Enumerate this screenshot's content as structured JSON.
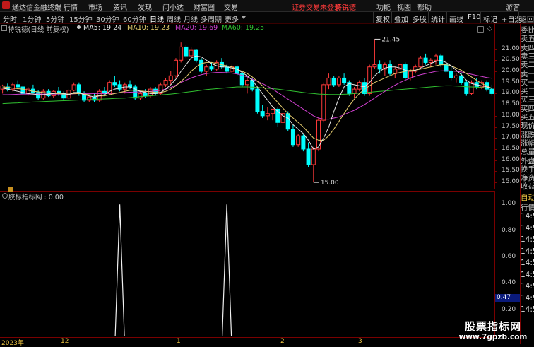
{
  "titlebar": {
    "app_name": "通达信金融终端",
    "menus": [
      "行情",
      "市场",
      "资讯",
      "发现",
      "问小达",
      "财富圈",
      "交易"
    ],
    "notice": "证券交易未登录",
    "stock_name": "特锐德",
    "right_items": [
      "功能",
      "视图",
      "帮助",
      "游客"
    ]
  },
  "toolbar": {
    "periods": [
      "分时",
      "1分钟",
      "5分钟",
      "15分钟",
      "30分钟",
      "60分钟",
      "日线",
      "周线",
      "月线",
      "多周期",
      "更多"
    ],
    "active_period": "日线",
    "right_buttons": [
      "复权",
      "叠加",
      "多股",
      "统计",
      "画线",
      "F10",
      "标记",
      "+自选",
      "返回"
    ]
  },
  "legend": {
    "title": "特锐德(日线 前复权)",
    "ma5": "MA5: 19.24",
    "ma10": "MA10: 19.23",
    "ma20": "MA20: 19.69",
    "ma60": "MA60: 19.25"
  },
  "colors": {
    "up": "#ff3a3a",
    "down": "#00ffff",
    "ma5": "#e8e8e8",
    "ma10": "#e8d070",
    "ma20": "#d040d0",
    "ma60": "#30c030",
    "axis": "#7a0000"
  },
  "price_axis": [
    "21.00",
    "20.50",
    "20.00",
    "19.50",
    "19.00",
    "18.50",
    "18.00",
    "17.50",
    "17.00",
    "16.50",
    "16.00",
    "15.50",
    "15.00"
  ],
  "annotations": {
    "high": "21.45",
    "low": "15.00"
  },
  "sub_panel": {
    "title": "胶标指标网 : 0.00",
    "axis": [
      "1.00",
      "0.80",
      "0.60",
      "0.40",
      "0.20"
    ],
    "current_value": "0.47"
  },
  "date_axis": [
    "2023年",
    "12",
    "1",
    "2",
    "3"
  ],
  "sidebar": {
    "top_labels": [
      "委比",
      "卖五",
      "卖四",
      "卖三",
      "卖二",
      "卖一",
      "买一",
      "买二",
      "买三",
      "买四",
      "买五",
      "现价",
      "涨跌",
      "涨幅",
      "总量",
      "外盘",
      "换手",
      "净资",
      "收益"
    ],
    "auto_label": "自动",
    "market_label": "行情",
    "times": [
      "14:5",
      "14:5",
      "14:5",
      "14:5",
      "14:5",
      "14:5",
      "14:5",
      "14:5",
      "14:5"
    ]
  },
  "watermark": {
    "line1": "股票指标网",
    "line2": "www.7gpzb.com"
  },
  "chart_data": {
    "type": "candlestick",
    "ylim": [
      14.75,
      21.75
    ],
    "candles": [
      [
        19.2,
        19.4,
        19.0,
        19.35
      ],
      [
        19.3,
        19.45,
        19.1,
        19.2
      ],
      [
        19.2,
        19.5,
        19.1,
        19.4
      ],
      [
        19.4,
        19.6,
        19.2,
        19.3
      ],
      [
        19.3,
        19.4,
        18.9,
        19.0
      ],
      [
        19.0,
        19.3,
        18.9,
        19.2
      ],
      [
        19.2,
        19.4,
        19.0,
        19.05
      ],
      [
        19.05,
        19.15,
        18.7,
        18.8
      ],
      [
        18.8,
        19.2,
        18.7,
        19.1
      ],
      [
        19.1,
        19.2,
        18.85,
        18.9
      ],
      [
        18.9,
        19.15,
        18.8,
        19.1
      ],
      [
        19.1,
        19.3,
        18.9,
        19.0
      ],
      [
        19.0,
        19.1,
        18.7,
        18.8
      ],
      [
        18.8,
        19.2,
        18.7,
        19.15
      ],
      [
        19.15,
        19.5,
        19.1,
        19.4
      ],
      [
        19.4,
        19.5,
        18.9,
        19.0
      ],
      [
        19.0,
        19.1,
        18.6,
        18.7
      ],
      [
        18.7,
        18.9,
        18.6,
        18.85
      ],
      [
        18.85,
        19.0,
        18.6,
        18.7
      ],
      [
        18.7,
        19.2,
        18.6,
        19.1
      ],
      [
        19.1,
        19.3,
        18.9,
        19.0
      ],
      [
        19.0,
        19.6,
        18.95,
        19.5
      ],
      [
        19.5,
        19.8,
        19.3,
        19.4
      ],
      [
        19.4,
        19.6,
        19.1,
        19.2
      ],
      [
        19.2,
        19.5,
        19.0,
        19.4
      ],
      [
        19.4,
        19.6,
        19.2,
        19.3
      ],
      [
        19.3,
        19.4,
        18.7,
        18.8
      ],
      [
        18.8,
        19.1,
        18.7,
        19.0
      ],
      [
        19.0,
        19.2,
        18.8,
        18.9
      ],
      [
        18.9,
        19.3,
        18.8,
        19.2
      ],
      [
        19.2,
        19.3,
        18.9,
        19.0
      ],
      [
        19.0,
        19.5,
        18.95,
        19.4
      ],
      [
        19.4,
        19.7,
        19.3,
        19.6
      ],
      [
        19.6,
        20.0,
        19.4,
        19.8
      ],
      [
        19.8,
        20.6,
        19.7,
        20.5
      ],
      [
        20.5,
        21.3,
        20.4,
        21.1
      ],
      [
        21.1,
        21.2,
        20.6,
        20.7
      ],
      [
        20.7,
        21.1,
        20.6,
        20.95
      ],
      [
        20.95,
        21.0,
        20.4,
        20.5
      ],
      [
        20.5,
        20.6,
        19.9,
        20.0
      ],
      [
        20.0,
        20.3,
        19.8,
        20.2
      ],
      [
        20.2,
        20.4,
        20.0,
        20.1
      ],
      [
        20.1,
        20.5,
        20.0,
        20.4
      ],
      [
        20.4,
        20.6,
        20.1,
        20.2
      ],
      [
        20.2,
        20.3,
        19.9,
        20.0
      ],
      [
        20.0,
        20.3,
        19.9,
        20.2
      ],
      [
        20.2,
        20.3,
        19.8,
        19.9
      ],
      [
        19.9,
        20.0,
        19.3,
        19.4
      ],
      [
        19.4,
        19.7,
        19.0,
        19.6
      ],
      [
        19.6,
        19.7,
        19.1,
        19.2
      ],
      [
        19.2,
        19.3,
        18.1,
        18.2
      ],
      [
        18.2,
        18.5,
        17.9,
        18.0
      ],
      [
        18.0,
        18.4,
        17.8,
        18.1
      ],
      [
        18.1,
        18.3,
        17.8,
        18.3
      ],
      [
        18.3,
        18.4,
        17.5,
        17.7
      ],
      [
        17.7,
        18.2,
        17.6,
        18.1
      ],
      [
        18.1,
        18.2,
        17.3,
        17.4
      ],
      [
        17.4,
        17.6,
        16.6,
        16.7
      ],
      [
        16.7,
        17.2,
        16.6,
        17.1
      ],
      [
        17.1,
        17.2,
        16.4,
        16.5
      ],
      [
        16.5,
        16.8,
        15.7,
        15.8
      ],
      [
        15.8,
        16.6,
        15.0,
        16.5
      ],
      [
        16.5,
        17.9,
        16.4,
        17.8
      ],
      [
        17.8,
        19.5,
        17.7,
        19.4
      ],
      [
        19.4,
        19.9,
        19.2,
        19.7
      ],
      [
        19.7,
        19.8,
        19.3,
        19.4
      ],
      [
        19.4,
        19.8,
        19.3,
        19.7
      ],
      [
        19.7,
        19.9,
        19.4,
        19.5
      ],
      [
        19.5,
        19.6,
        18.9,
        19.0
      ],
      [
        19.0,
        19.3,
        18.8,
        19.2
      ],
      [
        19.2,
        19.6,
        19.1,
        19.5
      ],
      [
        19.5,
        19.7,
        18.9,
        19.0
      ],
      [
        19.0,
        20.3,
        18.9,
        20.2
      ],
      [
        20.2,
        21.45,
        20.1,
        20.3
      ],
      [
        20.3,
        20.5,
        19.9,
        20.1
      ],
      [
        20.1,
        20.4,
        19.8,
        20.3
      ],
      [
        20.3,
        20.5,
        19.8,
        19.9
      ],
      [
        19.9,
        20.2,
        19.7,
        20.1
      ],
      [
        20.1,
        20.4,
        19.9,
        20.3
      ],
      [
        20.3,
        20.4,
        19.6,
        19.7
      ],
      [
        19.7,
        20.1,
        19.6,
        20.0
      ],
      [
        20.0,
        20.3,
        19.9,
        20.2
      ],
      [
        20.2,
        20.7,
        20.1,
        20.6
      ],
      [
        20.6,
        20.8,
        20.3,
        20.4
      ],
      [
        20.4,
        20.6,
        20.2,
        20.5
      ],
      [
        20.5,
        20.8,
        20.3,
        20.7
      ],
      [
        20.7,
        20.8,
        20.2,
        20.3
      ],
      [
        20.3,
        20.5,
        19.9,
        20.0
      ],
      [
        20.0,
        20.2,
        19.6,
        19.7
      ],
      [
        19.7,
        19.9,
        19.5,
        19.8
      ],
      [
        19.8,
        19.9,
        19.4,
        19.5
      ],
      [
        19.5,
        19.6,
        18.9,
        19.0
      ],
      [
        19.0,
        19.6,
        18.95,
        19.5
      ],
      [
        19.5,
        19.7,
        19.2,
        19.3
      ],
      [
        19.3,
        19.6,
        19.2,
        19.5
      ],
      [
        19.5,
        19.6,
        19.1,
        19.2
      ],
      [
        19.2,
        19.4,
        18.9,
        19.0
      ]
    ],
    "ma5": [
      19.25,
      19.2,
      19.15,
      19.1,
      19.05,
      19.0,
      18.98,
      18.95,
      18.95,
      18.98,
      19.0,
      19.05,
      19.0,
      18.95,
      19.05,
      19.05,
      18.95,
      18.9,
      18.85,
      18.9,
      18.95,
      19.1,
      19.2,
      19.25,
      19.3,
      19.3,
      19.2,
      19.1,
      19.05,
      19.0,
      19.0,
      19.05,
      19.2,
      19.4,
      19.65,
      20.0,
      20.3,
      20.6,
      20.7,
      20.65,
      20.5,
      20.35,
      20.25,
      20.2,
      20.2,
      20.15,
      20.1,
      19.95,
      19.8,
      19.6,
      19.3,
      19.0,
      18.7,
      18.4,
      18.2,
      18.0,
      17.9,
      17.6,
      17.4,
      17.2,
      16.9,
      16.5,
      16.6,
      17.0,
      17.5,
      18.2,
      18.8,
      19.3,
      19.45,
      19.4,
      19.35,
      19.3,
      19.5,
      19.8,
      20.0,
      20.15,
      20.2,
      20.2,
      20.15,
      20.05,
      20.0,
      20.05,
      20.15,
      20.25,
      20.35,
      20.45,
      20.5,
      20.4,
      20.25,
      20.05,
      19.85,
      19.6,
      19.45,
      19.4,
      19.35,
      19.3,
      19.24
    ],
    "ma10": [
      19.3,
      19.28,
      19.25,
      19.22,
      19.2,
      19.15,
      19.1,
      19.08,
      19.05,
      19.02,
      19.0,
      19.0,
      18.98,
      18.98,
      19.0,
      19.0,
      18.98,
      18.95,
      18.92,
      18.9,
      18.9,
      18.95,
      19.0,
      19.05,
      19.1,
      19.15,
      19.15,
      19.12,
      19.1,
      19.08,
      19.05,
      19.05,
      19.1,
      19.2,
      19.35,
      19.55,
      19.75,
      20.0,
      20.2,
      20.35,
      20.4,
      20.4,
      20.35,
      20.3,
      20.25,
      20.2,
      20.1,
      20.0,
      19.9,
      19.75,
      19.55,
      19.35,
      19.1,
      18.85,
      18.6,
      18.35,
      18.1,
      17.9,
      17.7,
      17.5,
      17.25,
      17.0,
      16.9,
      16.9,
      17.1,
      17.4,
      17.75,
      18.1,
      18.45,
      18.75,
      19.0,
      19.2,
      19.35,
      19.5,
      19.6,
      19.7,
      19.8,
      19.9,
      19.95,
      20.0,
      20.05,
      20.05,
      20.1,
      20.15,
      20.2,
      20.25,
      20.3,
      20.3,
      20.25,
      20.15,
      20.05,
      19.9,
      19.75,
      19.6,
      19.45,
      19.35,
      19.23
    ],
    "ma20": [
      18.95,
      18.95,
      18.96,
      18.97,
      18.98,
      18.98,
      18.98,
      18.98,
      18.98,
      18.98,
      18.98,
      18.98,
      18.98,
      18.98,
      18.99,
      19.0,
      19.0,
      19.0,
      19.0,
      19.0,
      19.0,
      19.01,
      19.02,
      19.03,
      19.05,
      19.06,
      19.07,
      19.08,
      19.09,
      19.1,
      19.12,
      19.15,
      19.2,
      19.28,
      19.38,
      19.5,
      19.6,
      19.7,
      19.78,
      19.85,
      19.9,
      19.93,
      19.95,
      19.95,
      19.94,
      19.92,
      19.88,
      19.82,
      19.75,
      19.65,
      19.55,
      19.45,
      19.33,
      19.2,
      19.05,
      18.9,
      18.75,
      18.6,
      18.45,
      18.3,
      18.15,
      18.0,
      17.9,
      17.85,
      17.85,
      17.9,
      17.95,
      18.05,
      18.15,
      18.25,
      18.38,
      18.5,
      18.65,
      18.8,
      18.95,
      19.1,
      19.25,
      19.38,
      19.5,
      19.6,
      19.7,
      19.78,
      19.85,
      19.9,
      19.95,
      20.0,
      20.02,
      20.03,
      20.02,
      20.0,
      19.97,
      19.92,
      19.87,
      19.82,
      19.77,
      19.72,
      19.69
    ],
    "ma60": [
      18.55,
      18.56,
      18.57,
      18.58,
      18.6,
      18.61,
      18.62,
      18.63,
      18.64,
      18.65,
      18.66,
      18.67,
      18.68,
      18.69,
      18.7,
      18.71,
      18.72,
      18.73,
      18.74,
      18.75,
      18.76,
      18.77,
      18.78,
      18.79,
      18.8,
      18.82,
      18.84,
      18.86,
      18.88,
      18.9,
      18.92,
      18.94,
      18.96,
      18.98,
      19.0,
      19.03,
      19.06,
      19.09,
      19.12,
      19.15,
      19.18,
      19.2,
      19.22,
      19.24,
      19.26,
      19.28,
      19.3,
      19.3,
      19.3,
      19.29,
      19.28,
      19.26,
      19.24,
      19.22,
      19.2,
      19.17,
      19.14,
      19.11,
      19.08,
      19.05,
      19.02,
      19.0,
      18.98,
      18.97,
      18.96,
      18.96,
      18.96,
      18.97,
      18.98,
      19.0,
      19.02,
      19.04,
      19.06,
      19.08,
      19.1,
      19.12,
      19.14,
      19.16,
      19.18,
      19.2,
      19.22,
      19.24,
      19.26,
      19.28,
      19.3,
      19.32,
      19.34,
      19.35,
      19.35,
      19.34,
      19.33,
      19.31,
      19.3,
      19.29,
      19.27,
      19.26,
      19.25
    ],
    "indicator": {
      "type": "line",
      "ylim": [
        0,
        1.05
      ],
      "spikes": [
        23,
        44
      ],
      "series_length": 97,
      "value": 0.0
    }
  }
}
